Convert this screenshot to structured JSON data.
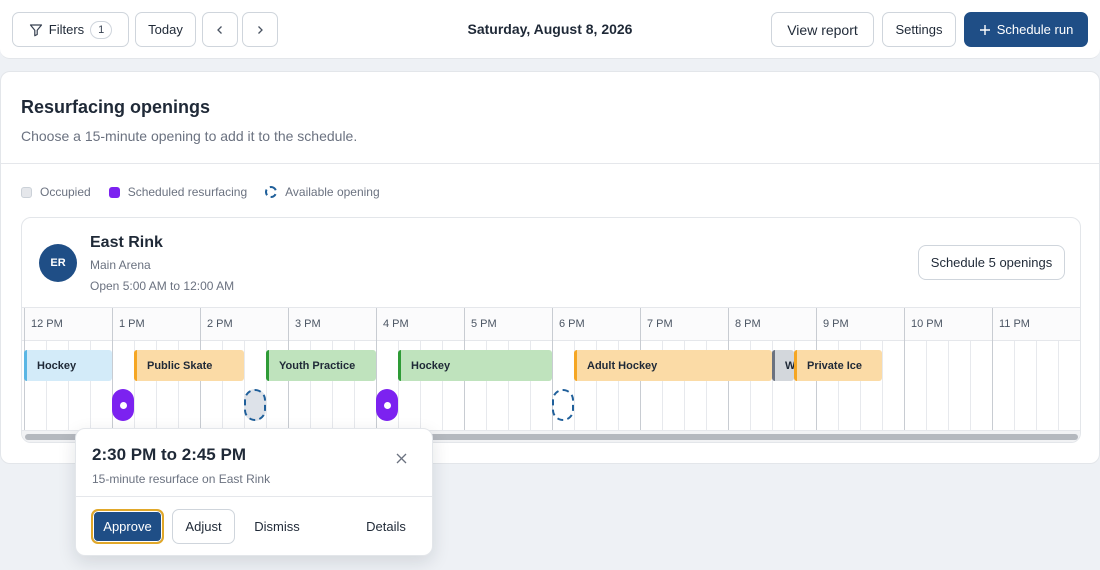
{
  "toolbar": {
    "filters_label": "Filters",
    "filters_count": "1",
    "today_label": "Today",
    "prev_icon": "chevron-left",
    "next_icon": "chevron-right",
    "date": "Saturday, August 8, 2026",
    "view_report_label": "View report",
    "settings_label": "Settings",
    "schedule_run_label": "Schedule run",
    "accent_color": "#1f4e86"
  },
  "panel": {
    "title": "Resurfacing openings",
    "subtitle": "Choose a 15-minute opening to add it to the schedule."
  },
  "legend": {
    "occupied": "Occupied",
    "scheduled": "Scheduled resurfacing",
    "available": "Available opening",
    "scheduled_color": "#7c22f0"
  },
  "rink": {
    "initials": "ER",
    "name": "East Rink",
    "subtitle": "Main Arena",
    "hours": "Open 5:00 AM to 12:00 AM",
    "schedule_button": "Schedule 5 openings",
    "hours_labels": [
      "12 PM",
      "1 PM",
      "2 PM",
      "3 PM",
      "4 PM",
      "5 PM",
      "6 PM",
      "7 PM",
      "8 PM",
      "9 PM",
      "10 PM",
      "11 PM"
    ],
    "events": [
      {
        "label": "Hockey",
        "color": "blue"
      },
      {
        "label": "Public Skate",
        "color": "orange"
      },
      {
        "label": "Youth Practice",
        "color": "green"
      },
      {
        "label": "Hockey",
        "color": "green"
      },
      {
        "label": "Adult Hockey",
        "color": "orange"
      },
      {
        "label": "W",
        "color": "gray"
      },
      {
        "label": "Private Ice",
        "color": "orange"
      }
    ]
  },
  "popover": {
    "title": "2:30 PM to 2:45 PM",
    "subtitle": "15-minute resurface on East Rink",
    "approve_label": "Approve",
    "adjust_label": "Adjust",
    "dismiss_label": "Dismiss",
    "details_label": "Details"
  }
}
